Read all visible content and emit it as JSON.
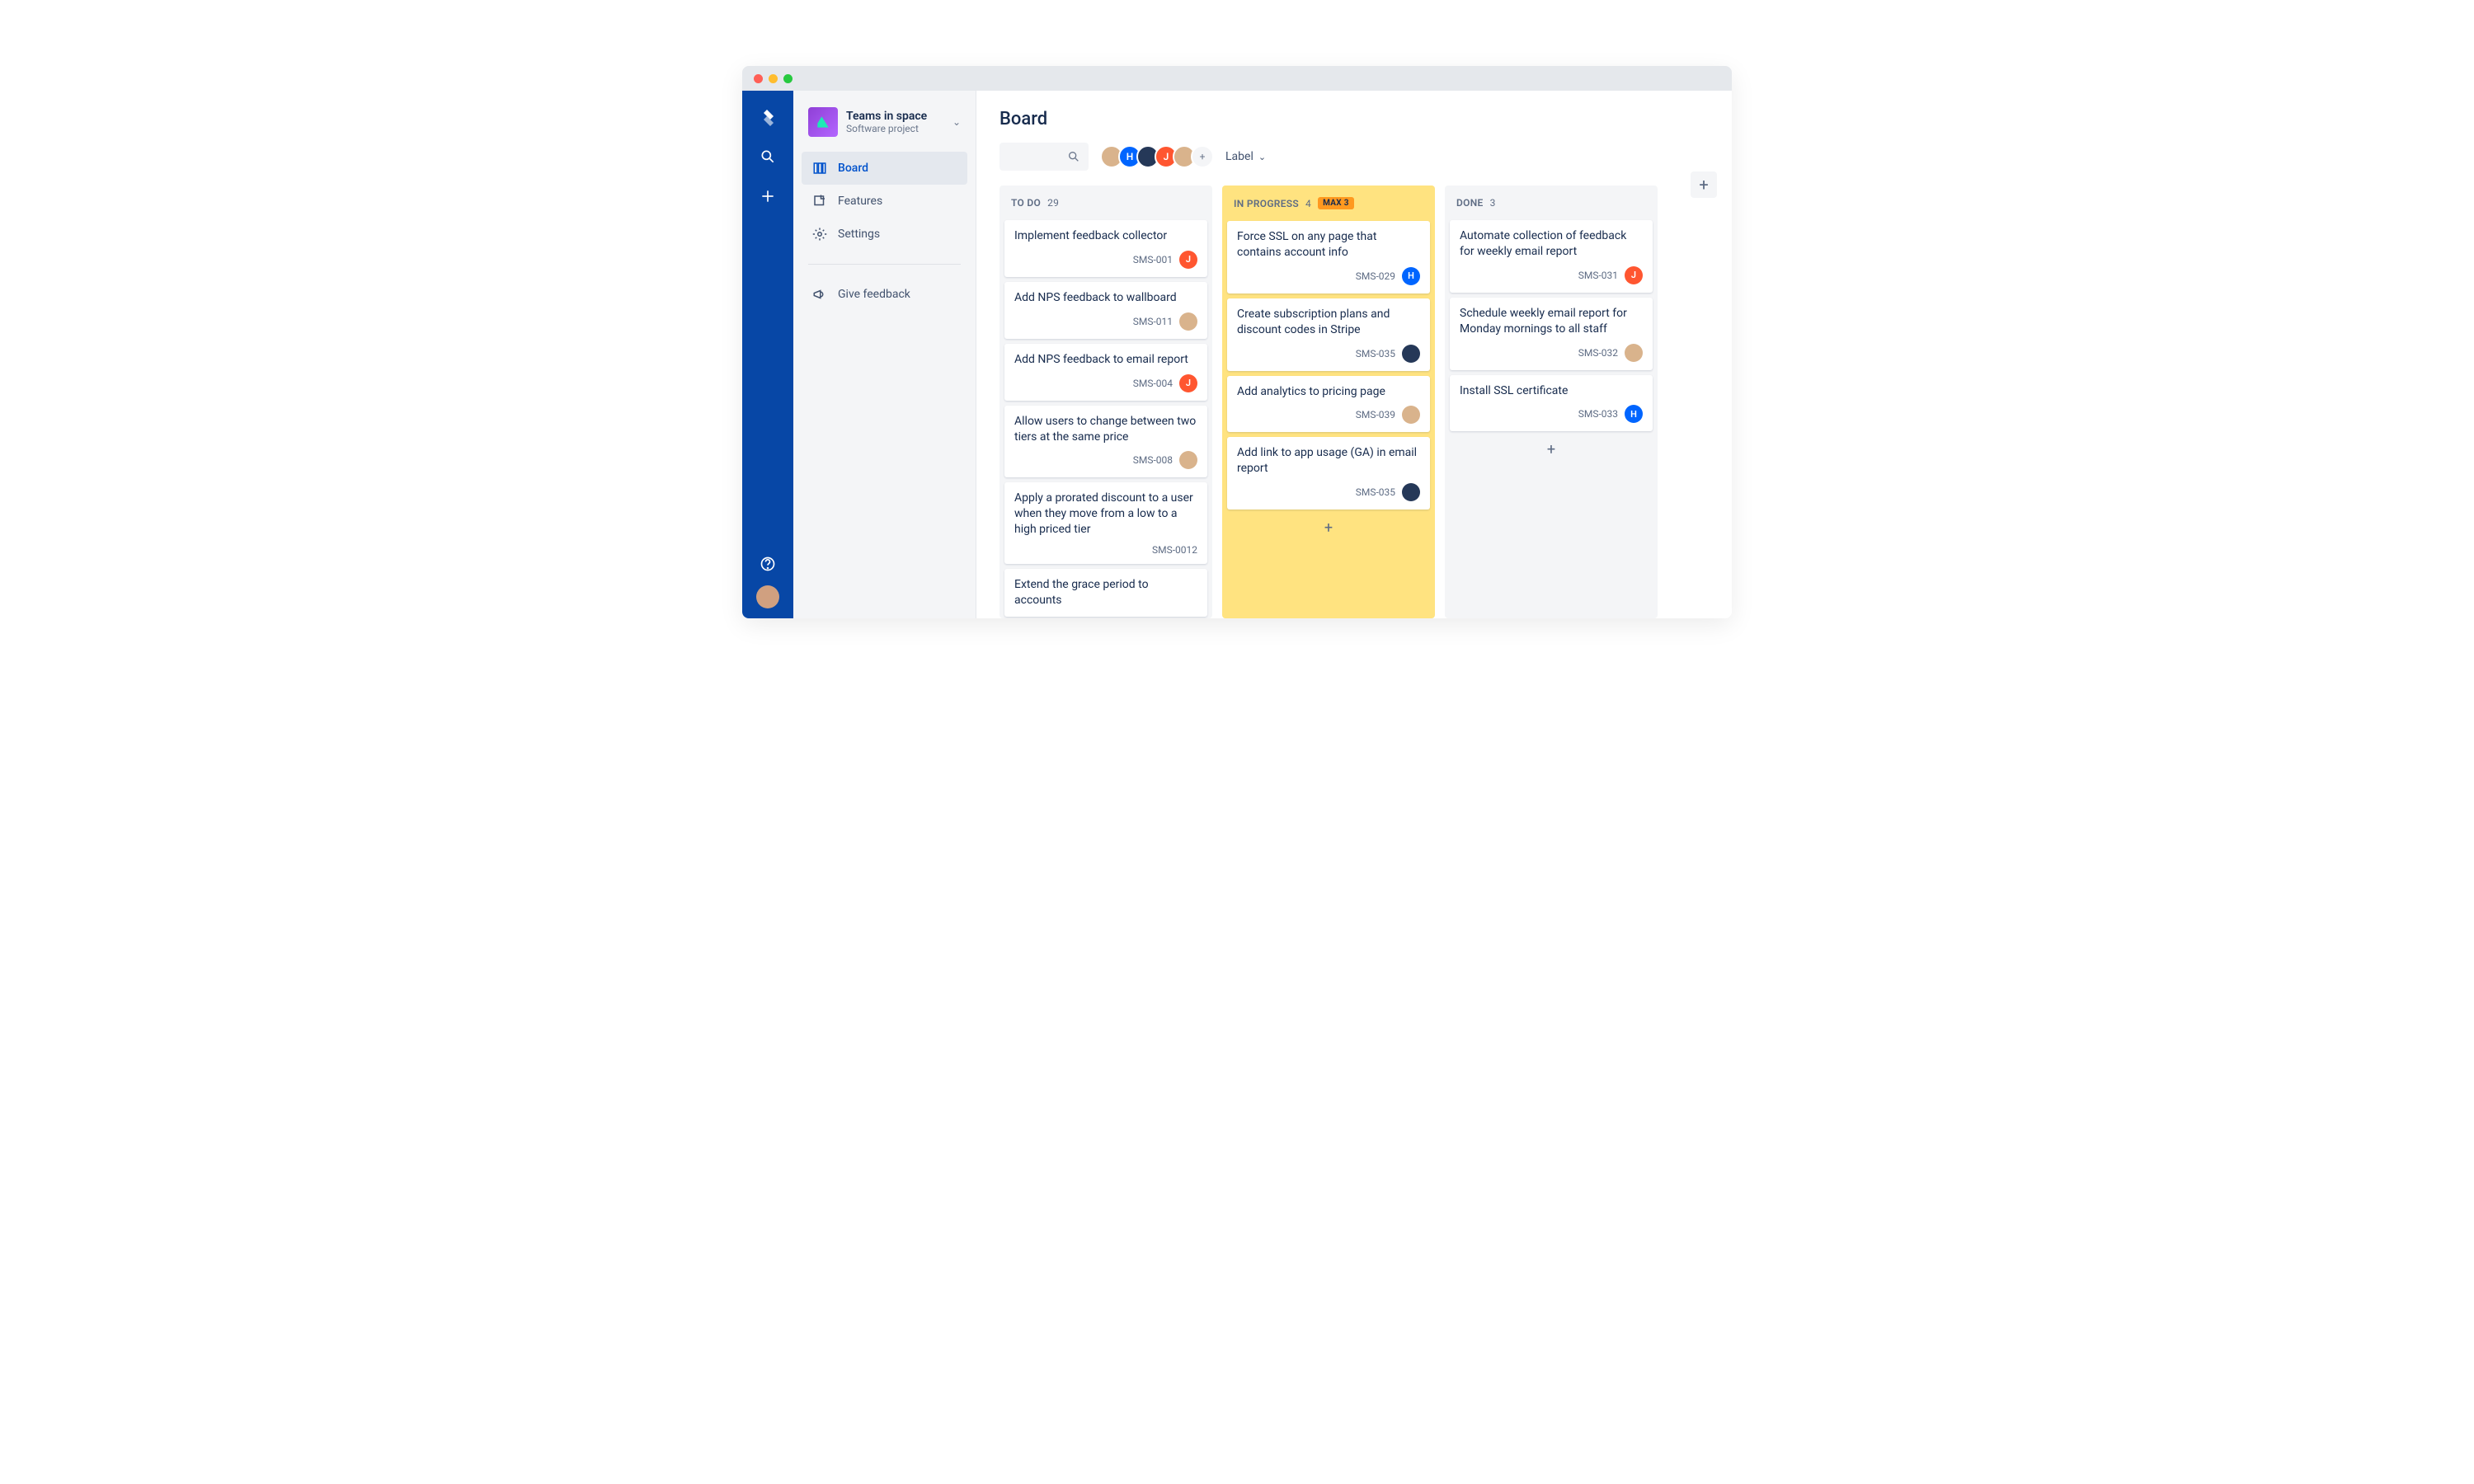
{
  "project": {
    "name": "Teams in space",
    "subtitle": "Software project"
  },
  "nav": {
    "board": "Board",
    "features": "Features",
    "settings": "Settings",
    "feedback": "Give feedback"
  },
  "page": {
    "title": "Board"
  },
  "toolbar": {
    "label": "Label",
    "avatars": [
      {
        "bg": "#d9b38c",
        "text": ""
      },
      {
        "bg": "#0065FF",
        "text": "H"
      },
      {
        "bg": "#253858",
        "text": ""
      },
      {
        "bg": "#FF5630",
        "text": "J"
      },
      {
        "bg": "#d9b38c",
        "text": ""
      }
    ]
  },
  "columns": [
    {
      "title": "To do",
      "count": "29",
      "warn": false,
      "cards": [
        {
          "title": "Implement feedback collector",
          "key": "SMS-001",
          "assignee": {
            "bg": "#FF5630",
            "text": "J"
          }
        },
        {
          "title": "Add NPS feedback to wallboard",
          "key": "SMS-011",
          "assignee": {
            "bg": "#d9b38c",
            "text": ""
          }
        },
        {
          "title": "Add NPS feedback to email report",
          "key": "SMS-004",
          "assignee": {
            "bg": "#FF5630",
            "text": "J"
          }
        },
        {
          "title": "Allow users to change between two tiers at the same price",
          "key": "SMS-008",
          "assignee": {
            "bg": "#d9b38c",
            "text": ""
          }
        },
        {
          "title": "Apply a prorated discount to a user when they move from a low to a high priced tier",
          "key": "SMS-0012",
          "assignee": null
        },
        {
          "title": "Extend the grace period to accounts",
          "key": "",
          "assignee": null
        }
      ]
    },
    {
      "title": "In progress",
      "count": "4",
      "warn": true,
      "badge": "MAX 3",
      "cards": [
        {
          "title": "Force SSL on any page that contains account info",
          "key": "SMS-029",
          "assignee": {
            "bg": "#0065FF",
            "text": "H"
          }
        },
        {
          "title": "Create subscription plans and discount codes in Stripe",
          "key": "SMS-035",
          "assignee": {
            "bg": "#253858",
            "text": ""
          }
        },
        {
          "title": "Add analytics to pricing page",
          "key": "SMS-039",
          "assignee": {
            "bg": "#d9b38c",
            "text": ""
          }
        },
        {
          "title": "Add link to app usage (GA) in email report",
          "key": "SMS-035",
          "assignee": {
            "bg": "#253858",
            "text": ""
          }
        }
      ]
    },
    {
      "title": "Done",
      "count": "3",
      "warn": false,
      "cards": [
        {
          "title": "Automate collection of feedback for weekly email report",
          "key": "SMS-031",
          "assignee": {
            "bg": "#FF5630",
            "text": "J"
          }
        },
        {
          "title": "Schedule weekly email report for Monday mornings to all staff",
          "key": "SMS-032",
          "assignee": {
            "bg": "#d9b38c",
            "text": ""
          }
        },
        {
          "title": "Install SSL certificate",
          "key": "SMS-033",
          "assignee": {
            "bg": "#0065FF",
            "text": "H"
          }
        }
      ]
    }
  ]
}
